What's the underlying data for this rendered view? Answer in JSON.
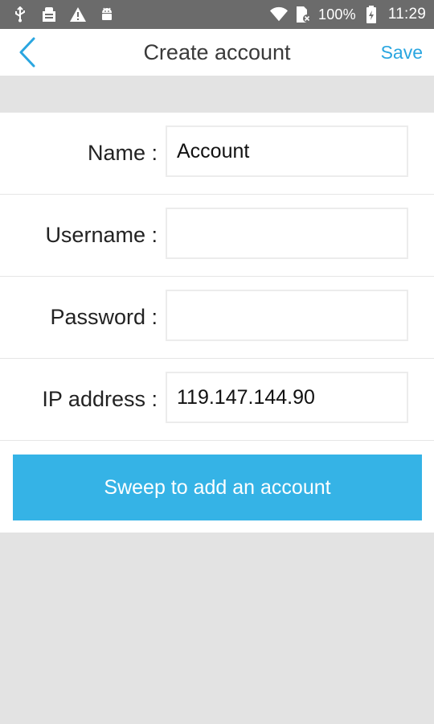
{
  "status_bar": {
    "icons_left": [
      "usb-icon",
      "debug-icon",
      "warning-icon",
      "android-icon"
    ],
    "battery_text": "100%",
    "time": "11:29"
  },
  "header": {
    "title": "Create account",
    "save_label": "Save",
    "accent_color": "#2aa6e0"
  },
  "form": {
    "rows": [
      {
        "label": "Name :",
        "value": "Account"
      },
      {
        "label": "Username :",
        "value": ""
      },
      {
        "label": "Password :",
        "value": ""
      },
      {
        "label": "IP address :",
        "value": "119.147.144.90"
      }
    ],
    "sweep_button_label": "Sweep to add an account",
    "button_color": "#35b3e6"
  }
}
